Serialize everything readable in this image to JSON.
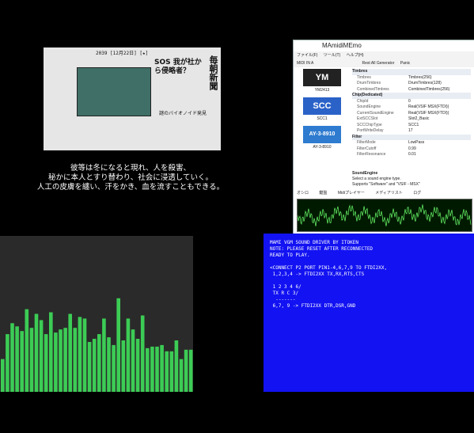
{
  "news": {
    "date": "2039 [12月22日] [★]",
    "headline": "SOS 我が社から侵略者？",
    "masthead": "毎朝新聞",
    "subtitle": "謎のバイオノイド発見"
  },
  "subtitle_lines": [
    "彼等は冬になると現れ、人を殺害、",
    "秘かに本人とすり替わり、社会に浸透していく。",
    "人工の皮膚を纏い、汗をかき、血を流すこともできる。"
  ],
  "app": {
    "title": "MAmidiMEmo",
    "menus": [
      "ファイル(F)",
      "ツール(T)",
      "ヘルプ(H)"
    ],
    "toolbar": [
      "MIDI IN A",
      "Rest All Generator",
      "Panic"
    ],
    "chips": [
      {
        "name": "YM2413",
        "logo": "YM"
      },
      {
        "name": "SCC1",
        "logo": "SCC"
      },
      {
        "name": "AY-3-8910",
        "logo": "AY-3-8910"
      }
    ],
    "sections": [
      {
        "title": "Timbres",
        "rows": [
          [
            "Timbres",
            "Timbres(256)"
          ],
          [
            "DrumTimbres",
            "DrumTimbres(128)"
          ],
          [
            "CombinedTimbres",
            "CombinedTimbres(256)"
          ]
        ]
      },
      {
        "title": "Chip(Dedicated)",
        "rows": [
          [
            "ChipId",
            "0"
          ],
          [
            "SoundEngine",
            "Real(VSIF MSX(FTDI))"
          ],
          [
            "CurrentSoundEngine",
            "Real(VSIF MSX(FTDI))"
          ],
          [
            "ExtSCCSlot",
            "Slot2_Basic"
          ],
          [
            "SCCChipType",
            "SCC1"
          ],
          [
            "PortWriteDelay",
            "17"
          ]
        ]
      },
      {
        "title": "Filter",
        "rows": [
          [
            "FilterMode",
            "LowPass"
          ],
          [
            "FilterCutoff",
            "0.99"
          ],
          [
            "FilterResonance",
            "0.01"
          ]
        ]
      }
    ],
    "desc_title": "SoundEngine",
    "desc_lines": [
      "Select a sound engine type.",
      "Supports \"Software\" and \"VSIF - MSX\""
    ],
    "tabs": [
      "オシロ",
      "鍵盤",
      "Midiプレイヤー",
      "メディアリスト",
      "ログ"
    ]
  },
  "spectrum": {
    "bar_color": "#3ccc55",
    "levels": [
      0.21,
      0.37,
      0.44,
      0.42,
      0.39,
      0.53,
      0.41,
      0.5,
      0.46,
      0.37,
      0.51,
      0.38,
      0.4,
      0.41,
      0.5,
      0.41,
      0.48,
      0.47,
      0.32,
      0.34,
      0.37,
      0.47,
      0.35,
      0.3,
      0.6,
      0.33,
      0.47,
      0.4,
      0.34,
      0.49,
      0.28,
      0.29,
      0.29,
      0.3,
      0.26,
      0.26,
      0.33,
      0.21,
      0.27,
      0.27
    ]
  },
  "msx": {
    "lines": [
      "MAMI VGM SOUND DRIVER BY ITOKEN",
      "NOTE: PLEASE RESET AFTER RECONNECTED",
      "READY TO PLAY.",
      "",
      "<CONNECT P2 PORT PIN1-4,6,7,9 TO FTDI2XX,",
      " 1,2,3,4 -> FTDI2XX TX,RX,RTS,CTS",
      "",
      " 1 2 3 4 6/",
      " TX R C 3/",
      "  -------",
      " 6,7, 9 -> FTDI2XX DTR,DSR,GND"
    ]
  }
}
